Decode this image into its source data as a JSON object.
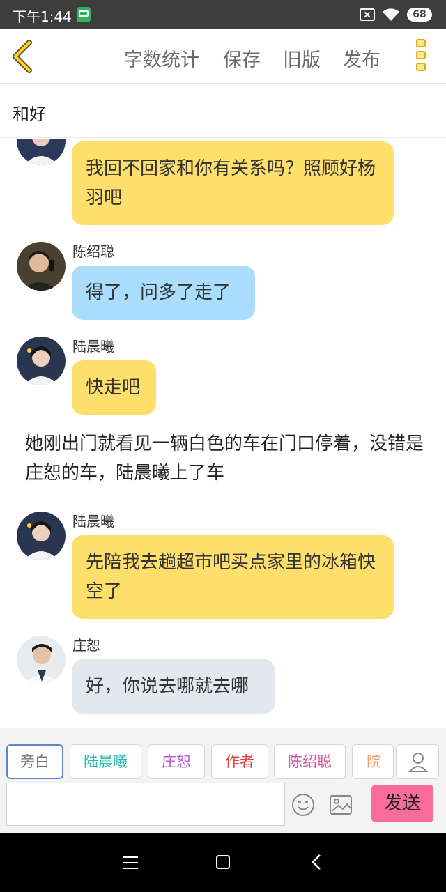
{
  "status_bar": {
    "time": "下午1:44",
    "battery": "68"
  },
  "toolbar": {
    "word_count": "字数统计",
    "save": "保存",
    "old_version": "旧版",
    "publish": "发布"
  },
  "title": "和好",
  "messages": [
    {
      "sender": "",
      "text": "我回不回家和你有关系吗？照顾好杨羽吧",
      "bubble_color": "#ffdf6b"
    },
    {
      "sender": "陈绍聪",
      "text": "得了，问多了走了",
      "bubble_color": "#a9ddfb"
    },
    {
      "sender": "陆晨曦",
      "text": "快走吧",
      "bubble_color": "#ffdf6b"
    },
    {
      "sender": "陆晨曦",
      "text": "先陪我去趟超市吧买点家里的冰箱快空了",
      "bubble_color": "#ffdf6b"
    },
    {
      "sender": "庄恕",
      "text": "好，你说去哪就去哪",
      "bubble_color": "#e3e8ee"
    }
  ],
  "narration": "她刚出门就看见一辆白色的车在门口停着，没错是庄恕的车，陆晨曦上了车",
  "roles": [
    {
      "label": "旁白",
      "color": "#777777"
    },
    {
      "label": "陆晨曦",
      "color": "#33b8b0"
    },
    {
      "label": "庄恕",
      "color": "#b45cd6"
    },
    {
      "label": "作者",
      "color": "#e2453c"
    },
    {
      "label": "陈绍聪",
      "color": "#d9559f"
    },
    {
      "label": "院长",
      "color": "#f0a070"
    }
  ],
  "input": {
    "placeholder": ""
  },
  "send_label": "发送",
  "icons": {
    "back": "chevron-left-icon",
    "more": "more-vertical-icon",
    "person": "person-icon",
    "emoji": "smiley-icon",
    "image": "image-icon"
  }
}
